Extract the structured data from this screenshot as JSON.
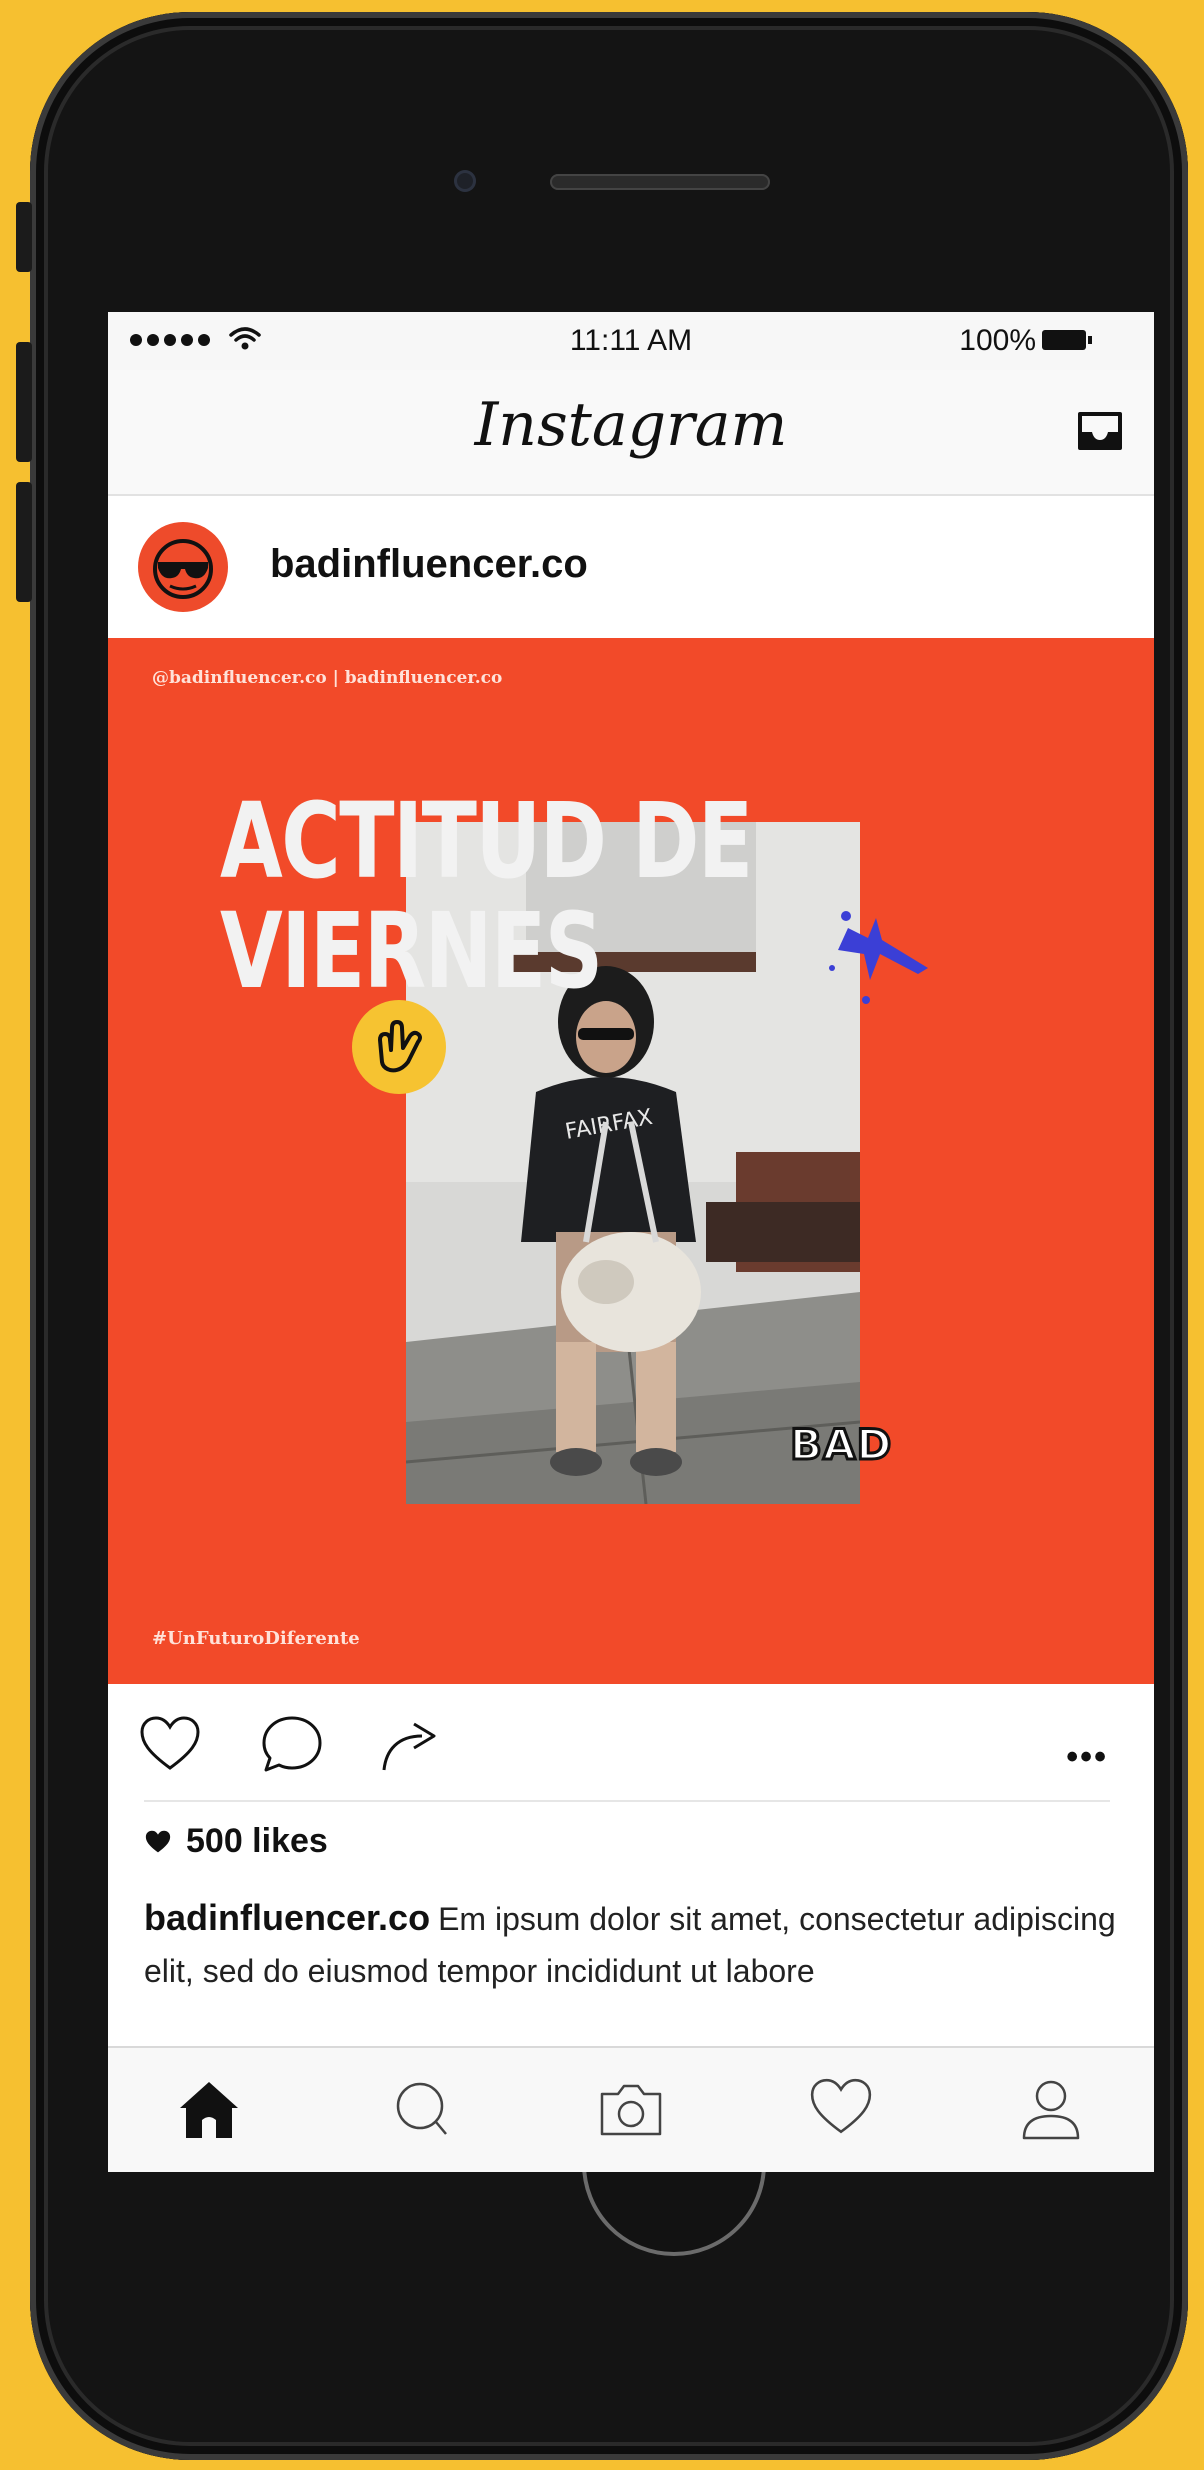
{
  "statusbar": {
    "time": "11:11 AM",
    "battery_percent": "100%"
  },
  "navbar": {
    "logo": "Instagram"
  },
  "post": {
    "username": "badinfluencer.co",
    "image": {
      "credit": "@badinfluencer.co | badinfluencer.co",
      "headline_line1": "ACTITUD DE",
      "headline_line2": "VIERNES",
      "sticker_text": "BAD",
      "hashtag": "#UnFuturoDiferente",
      "background_color": "#F24A29"
    },
    "likes": "500 likes",
    "caption_user": "badinfluencer.co",
    "caption_text": "Em ipsum dolor sit amet, consectetur adipiscing elit, sed do eiusmod tempor incididunt ut labore"
  },
  "icons": {
    "like": "heart-icon",
    "comment": "comment-icon",
    "share": "share-icon",
    "more": "more-icon",
    "inbox": "inbox-icon"
  },
  "tabbar": [
    "home-icon",
    "search-icon",
    "camera-icon",
    "heart-icon",
    "profile-icon"
  ],
  "colors": {
    "background": "#F6C030",
    "accent": "#F24A29",
    "sticker_yellow": "#F6C331",
    "splat_blue": "#3B3FD6"
  }
}
